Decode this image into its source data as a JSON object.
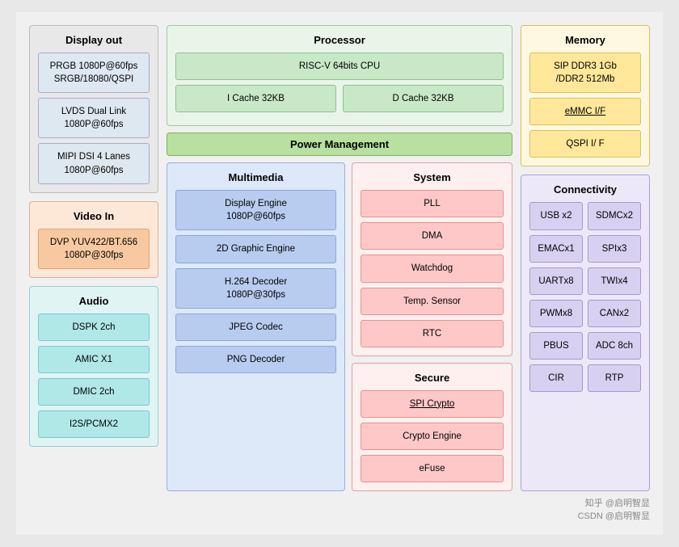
{
  "diagram": {
    "display_out": {
      "title": "Display out",
      "boxes": [
        "PRGB 1080P@60fps\nSRGB/18080/QSPI",
        "LVDS Dual Link\n1080P@60fps",
        "MIPI DSI 4 Lanes\n1080P@60fps"
      ]
    },
    "video_in": {
      "title": "Video In",
      "boxes": [
        "DVP YUV422/BT.656\n1080P@30fps"
      ]
    },
    "audio": {
      "title": "Audio",
      "boxes": [
        "DSPK 2ch",
        "AMIC X1",
        "DMIC 2ch",
        "I2S/PCMX2"
      ]
    },
    "processor": {
      "title": "Processor",
      "cpu": "RISC-V 64bits CPU",
      "cache_i": "I  Cache 32KB",
      "cache_d": "D Cache 32KB"
    },
    "power_management": {
      "title": "Power Management"
    },
    "multimedia": {
      "title": "Multimedia",
      "boxes": [
        "Display Engine\n1080P@60fps",
        "2D Graphic Engine",
        "H.264 Decoder\n1080P@30fps",
        "JPEG Codec",
        "PNG Decoder"
      ]
    },
    "system": {
      "title": "System",
      "boxes": [
        "PLL",
        "DMA",
        "Watchdog",
        "Temp. Sensor",
        "RTC"
      ]
    },
    "secure": {
      "title": "Secure",
      "boxes": [
        "SPI Crypto",
        "Crypto Engine",
        "eFuse"
      ]
    },
    "memory": {
      "title": "Memory",
      "boxes": [
        "SIP DDR3 1Gb\n/DDR2 512Mb",
        "eMMC I/F",
        "QSPI I/ F"
      ]
    },
    "connectivity": {
      "title": "Connectivity",
      "boxes": [
        "USB x2",
        "SDMCx2",
        "EMACx1",
        "SPIx3",
        "UARTx8",
        "TWIx4",
        "PWMx8",
        "CANx2",
        "PBUS",
        "ADC 8ch",
        "CIR",
        "RTP"
      ]
    },
    "watermark": "知乎 @启明智显\nCSDN @启明智显"
  }
}
